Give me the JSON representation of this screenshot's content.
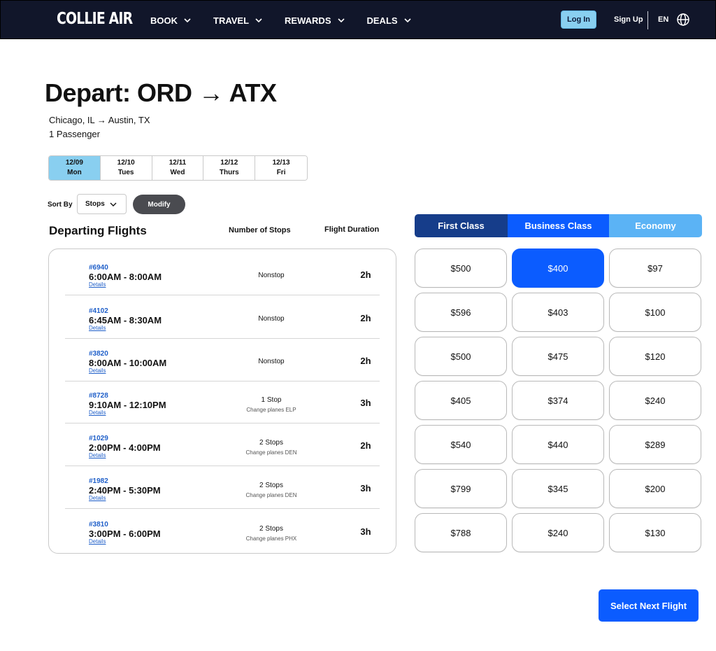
{
  "nav": {
    "logo": "COLLIE AIR",
    "menu": [
      "BOOK",
      "TRAVEL",
      "REWARDS",
      "DEALS"
    ],
    "login": "Log In",
    "signup": "Sign Up",
    "language": "EN"
  },
  "header": {
    "title": "Depart: ORD → ATX",
    "route": "Chicago, IL → Austin, TX",
    "passengers": "1 Passenger"
  },
  "dates": [
    {
      "date": "12/09",
      "day": "Mon",
      "active": true
    },
    {
      "date": "12/10",
      "day": "Tues",
      "active": false
    },
    {
      "date": "12/11",
      "day": "Wed",
      "active": false
    },
    {
      "date": "12/12",
      "day": "Thurs",
      "active": false
    },
    {
      "date": "12/13",
      "day": "Fri",
      "active": false
    }
  ],
  "sort": {
    "label": "Sort By",
    "value": "Stops",
    "modify": "Modify"
  },
  "columns": {
    "title": "Departing Flights",
    "stops": "Number of Stops",
    "duration": "Flight Duration"
  },
  "flights": [
    {
      "number": "#6940",
      "time": "6:00AM - 8:00AM",
      "details": "Details",
      "stops": "Nonstop",
      "change": "",
      "duration": "2h"
    },
    {
      "number": "#4102",
      "time": "6:45AM - 8:30AM",
      "details": "Details",
      "stops": "Nonstop",
      "change": "",
      "duration": "2h"
    },
    {
      "number": "#3820",
      "time": "8:00AM - 10:00AM",
      "details": "Details",
      "stops": "Nonstop",
      "change": "",
      "duration": "2h"
    },
    {
      "number": "#8728",
      "time": "9:10AM - 12:10PM",
      "details": "Details",
      "stops": "1 Stop",
      "change": "Change planes ELP",
      "duration": "3h"
    },
    {
      "number": "#1029",
      "time": "2:00PM - 4:00PM",
      "details": "Details",
      "stops": "2 Stops",
      "change": "Change planes DEN",
      "duration": "2h"
    },
    {
      "number": "#1982",
      "time": "2:40PM - 5:30PM",
      "details": "Details",
      "stops": "2 Stops",
      "change": "Change planes DEN",
      "duration": "3h"
    },
    {
      "number": "#3810",
      "time": "3:00PM - 6:00PM",
      "details": "Details",
      "stops": "2 Stops",
      "change": "Change planes PHX",
      "duration": "3h"
    }
  ],
  "fare_tabs": [
    {
      "label": "First Class",
      "color": "#163d8a"
    },
    {
      "label": "Business Class",
      "color": "#0b5cff"
    },
    {
      "label": "Economy",
      "color": "#5bb3f5"
    }
  ],
  "prices": [
    [
      "$500",
      "$400",
      "$97"
    ],
    [
      "$596",
      "$403",
      "$100"
    ],
    [
      "$500",
      "$475",
      "$120"
    ],
    [
      "$405",
      "$374",
      "$240"
    ],
    [
      "$540",
      "$440",
      "$289"
    ],
    [
      "$799",
      "$345",
      "$200"
    ],
    [
      "$788",
      "$240",
      "$130"
    ]
  ],
  "selected_price": {
    "row": 0,
    "col": 1
  },
  "next_button": "Select Next Flight"
}
